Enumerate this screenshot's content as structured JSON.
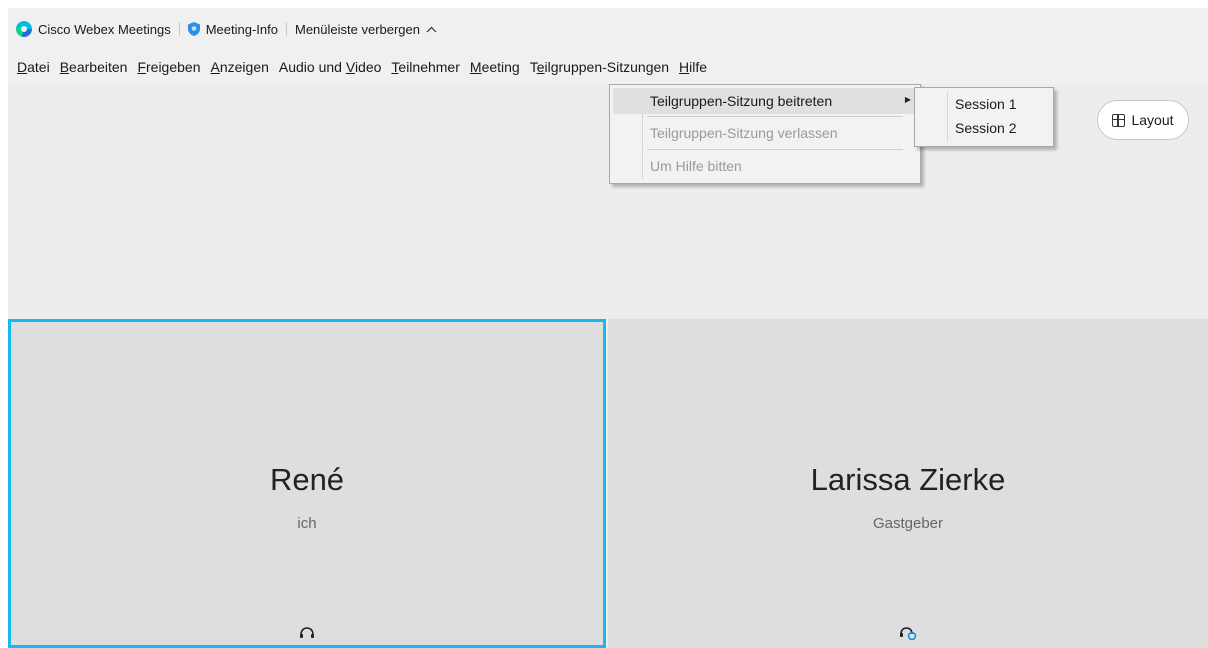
{
  "titlebar": {
    "app_name": "Cisco Webex Meetings",
    "meeting_info": "Meeting-Info",
    "hide_menu": "Menüleiste verbergen",
    "hide_menu_icon": "chevron-up-icon"
  },
  "menubar": {
    "items": [
      {
        "u": "D",
        "rest": "atei"
      },
      {
        "u": "B",
        "rest": "earbeiten"
      },
      {
        "u": "F",
        "rest": "reigeben"
      },
      {
        "u": "A",
        "rest": "nzeigen"
      },
      {
        "pre": "Audio und ",
        "u": "V",
        "rest": "ideo"
      },
      {
        "u": "T",
        "rest": "eilnehmer"
      },
      {
        "u": "M",
        "rest": "eeting"
      },
      {
        "pre": "T",
        "u": "e",
        "rest": "ilgruppen-Sitzungen"
      },
      {
        "u": "H",
        "rest": "ilfe"
      }
    ]
  },
  "dropdown": {
    "items": [
      {
        "pre": "T",
        "u": "e",
        "rest": "ilgruppen-Sitzung beitreten",
        "enabled": true,
        "has_submenu": true
      },
      {
        "pre": "Teilgruppen-Sitzung ",
        "u": "v",
        "rest": "erlassen",
        "enabled": false
      },
      {
        "pre": "Um Hilfe bitten",
        "u": "",
        "rest": "",
        "enabled": false
      }
    ]
  },
  "submenu": {
    "items": [
      "Session 1",
      "Session 2"
    ]
  },
  "layout_button": {
    "label": "Layout",
    "icon": "grid-icon"
  },
  "tiles": [
    {
      "name": "René",
      "role": "ich",
      "active_speaker": true,
      "icon": "headset-icon"
    },
    {
      "name": "Larissa Zierke",
      "role": "Gastgeber",
      "active_speaker": false,
      "icon": "headset-sync-icon"
    }
  ],
  "colors": {
    "active_border": "#16bbee",
    "tile_bg": "#dedede",
    "stage_bg": "#ededed"
  }
}
